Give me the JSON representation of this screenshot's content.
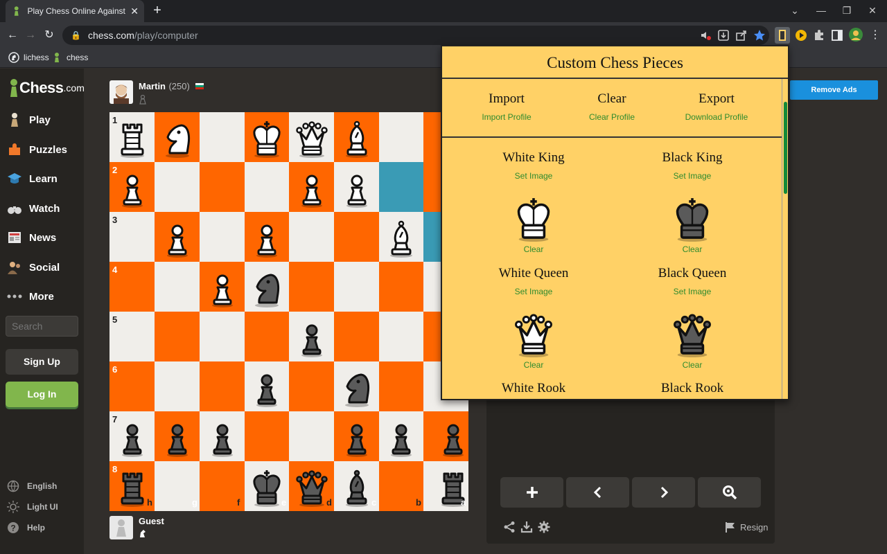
{
  "browser": {
    "tab_title": "Play Chess Online Against the Co",
    "url_host": "chess.com",
    "url_path": "/play/computer",
    "bookmarks": [
      "lichess",
      "chess"
    ]
  },
  "sidebar": {
    "logo_word": "Chess",
    "logo_domain": ".com",
    "nav": [
      "Play",
      "Puzzles",
      "Learn",
      "Watch",
      "News",
      "Social",
      "More"
    ],
    "search_placeholder": "Search",
    "signup": "Sign Up",
    "login": "Log In",
    "footer": [
      "English",
      "Light UI",
      "Help"
    ]
  },
  "players": {
    "top_name": "Martin",
    "top_rating": "(250)",
    "bottom_name": "Guest"
  },
  "board": {
    "ranks": [
      "1",
      "2",
      "3",
      "4",
      "5",
      "6",
      "7",
      "8"
    ],
    "files": [
      "h",
      "g",
      "f",
      "e",
      "d",
      "c",
      "b",
      "a"
    ]
  },
  "right_panel": {
    "remove_ads": "Remove Ads",
    "resign": "Resign"
  },
  "popup": {
    "title": "Custom Chess Pieces",
    "actions": [
      {
        "heading": "Import",
        "link": "Import Profile"
      },
      {
        "heading": "Clear",
        "link": "Clear Profile"
      },
      {
        "heading": "Export",
        "link": "Download Profile"
      }
    ],
    "pieces": [
      {
        "name": "White King",
        "set": "Set Image",
        "clear": "Clear"
      },
      {
        "name": "Black King",
        "set": "Set Image",
        "clear": "Clear"
      },
      {
        "name": "White Queen",
        "set": "Set Image",
        "clear": "Clear"
      },
      {
        "name": "Black Queen",
        "set": "Set Image",
        "clear": "Clear"
      },
      {
        "name": "White Rook"
      },
      {
        "name": "Black Rook"
      }
    ]
  },
  "colors": {
    "board_light": "#f0eeea",
    "board_dark": "#ff6600",
    "highlight": "#3a9bb5",
    "popup_bg": "#ffd166",
    "link_green": "#2e8b2e",
    "login_green": "#81b64c",
    "ads_blue": "#1a90dd"
  }
}
